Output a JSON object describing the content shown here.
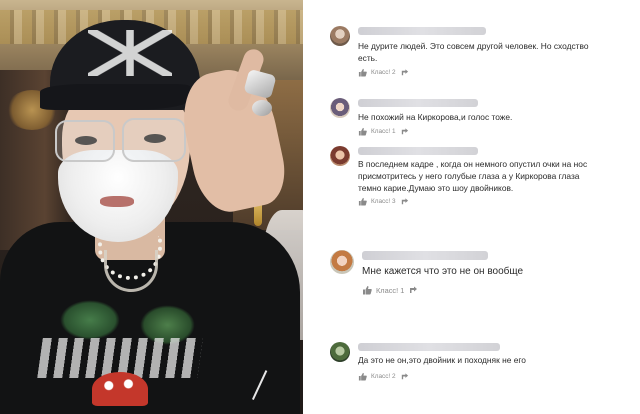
{
  "photo": {
    "subject": "man-in-cap-and-glasses"
  },
  "comments": [
    {
      "avatar_icon": "user-avatar-icon",
      "text": "Не дурите людей. Это совсем другой человек. Но сходство\nесть.",
      "likes_label": "Класс! 2",
      "like_icon": "thumbs-up-icon",
      "reshare_icon": "reshare-icon"
    },
    {
      "avatar_icon": "user-avatar-icon",
      "text": "Не похожий на Киркорова,и голос тоже.",
      "likes_label": "Класс! 1",
      "like_icon": "thumbs-up-icon",
      "reshare_icon": "reshare-icon"
    },
    {
      "avatar_icon": "user-avatar-icon",
      "text": "В последнем кадре , когда он немного опустил очки на нос\nприсмотритесь у него голубые глаза а у Киркорова глаза\nтемно карие.Думаю это шоу двойников.",
      "likes_label": "Класс! 3",
      "like_icon": "thumbs-up-icon",
      "reshare_icon": "reshare-icon"
    },
    {
      "avatar_icon": "user-avatar-icon",
      "text": "Мне кажется что это не он вообще",
      "likes_label": "Класс! 1",
      "like_icon": "thumbs-up-icon",
      "reshare_icon": "reshare-icon"
    },
    {
      "avatar_icon": "user-avatar-icon",
      "text": "Да это не он,это двойник и походняк не его",
      "likes_label": "Класс! 2",
      "like_icon": "thumbs-up-icon",
      "reshare_icon": "reshare-icon"
    }
  ],
  "colors": {
    "text": "#2b2b2b",
    "meta": "#8a8a8a",
    "like_icon": "#8a8a8a"
  }
}
